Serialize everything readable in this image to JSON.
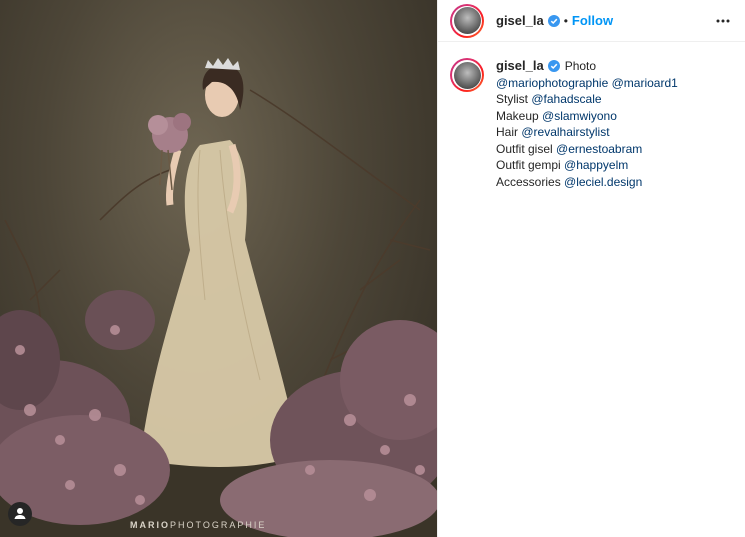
{
  "post": {
    "username": "gisel_la",
    "dot": "•",
    "follow_label": "Follow",
    "watermark_bold": "MARIO",
    "watermark_rest": "PHOTOGRAPHIE"
  },
  "caption": {
    "username": "gisel_la",
    "first_text": "Photo",
    "lines": [
      {
        "prefix": "",
        "mention": "@mariophotographie",
        "sep": " ",
        "mention2": "@marioard1"
      },
      {
        "prefix": "Stylist ",
        "mention": "@fahadscale"
      },
      {
        "prefix": "Makeup ",
        "mention": "@slamwiyono"
      },
      {
        "prefix": "Hair ",
        "mention": "@revalhairstylist"
      },
      {
        "prefix": "Outfit gisel ",
        "mention": "@ernestoabram"
      },
      {
        "prefix": "Outfit gempi ",
        "mention": "@happyelm"
      },
      {
        "prefix": "Accessories ",
        "mention": "@leciel.design"
      }
    ]
  },
  "icons": {
    "verified": "verified-badge-icon",
    "more": "more-options-icon",
    "tag": "user-tag-icon"
  },
  "colors": {
    "follow": "#0095f6",
    "mention": "#00376b",
    "verified": "#3897f0"
  }
}
